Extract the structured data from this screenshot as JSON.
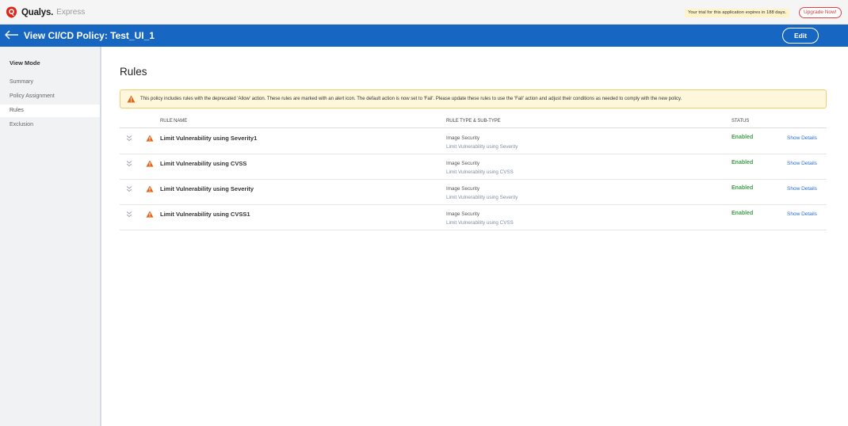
{
  "topbar": {
    "brand": "Qualys.",
    "brand_sub": "Express",
    "trial_text": "Your trial for this application expires in 188 days.",
    "upgrade_label": "Upgrade Now!"
  },
  "header": {
    "title": "View CI/CD Policy: Test_UI_1",
    "edit_label": "Edit"
  },
  "sidebar": {
    "heading": "View Mode",
    "items": [
      {
        "label": "Summary",
        "active": false
      },
      {
        "label": "Policy Assignment",
        "active": false
      },
      {
        "label": "Rules",
        "active": true
      },
      {
        "label": "Exclusion",
        "active": false
      }
    ]
  },
  "main": {
    "title": "Rules",
    "alert": "This policy includes rules with the deprecated 'Allow' action. These rules are marked with an alert icon. The default action is now set to 'Fail'. Please update these rules to use the 'Fail' action and adjust their conditions as needed to comply with the new policy.",
    "columns": [
      "RULE NAME",
      "RULE TYPE & SUB-TYPE",
      "STATUS"
    ],
    "rows": [
      {
        "name": "Limit Vulnerability using Severity1",
        "type": "Image Security",
        "subtype": "Limit Vulnerability using Severity",
        "status": "Enabled",
        "action": "Show Details"
      },
      {
        "name": "Limit Vulnerability using CVSS",
        "type": "Image Security",
        "subtype": "Limit Vulnerability using CVSS",
        "status": "Enabled",
        "action": "Show Details"
      },
      {
        "name": "Limit Vulnerability using Severity",
        "type": "Image Security",
        "subtype": "Limit Vulnerability using Severity",
        "status": "Enabled",
        "action": "Show Details"
      },
      {
        "name": "Limit Vulnerability using CVSS1",
        "type": "Image Security",
        "subtype": "Limit Vulnerability using CVSS",
        "status": "Enabled",
        "action": "Show Details"
      }
    ]
  },
  "colors": {
    "header_blue": "#1767c2",
    "status_green": "#3fa046",
    "warning_orange": "#e2661b",
    "link_blue": "#2b6fca"
  },
  "icons": [
    "qualys-logo-icon",
    "back-arrow-icon",
    "warning-icon",
    "chevron-down-double-icon"
  ]
}
